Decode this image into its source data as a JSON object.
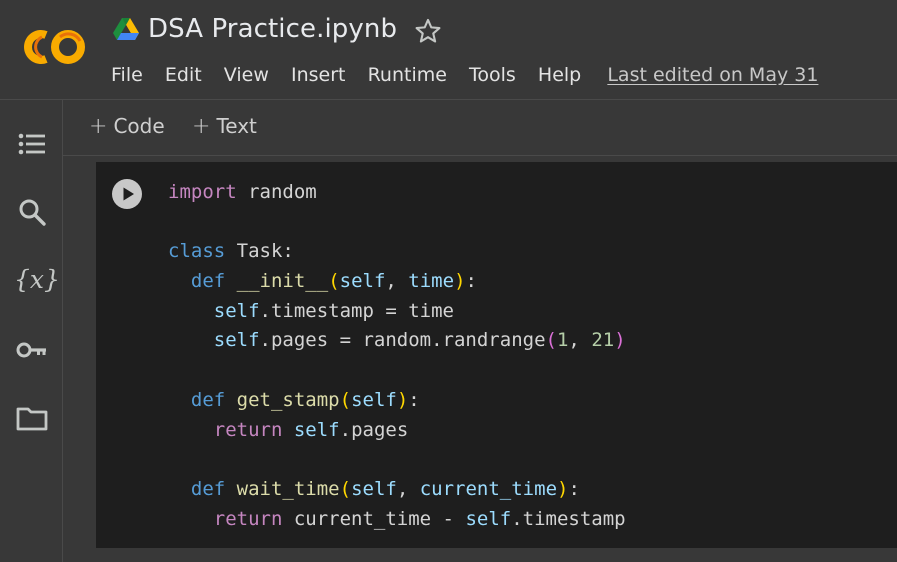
{
  "header": {
    "title": "DSA Practice.ipynb",
    "menu": [
      "File",
      "Edit",
      "View",
      "Insert",
      "Runtime",
      "Tools",
      "Help"
    ],
    "last_edited": "Last edited on May 31"
  },
  "toolbar": {
    "add_code_label": "Code",
    "add_text_label": "Text"
  },
  "sidebar": {
    "icons": [
      "table-of-contents-icon",
      "search-icon",
      "variables-icon",
      "key-icon",
      "folder-icon"
    ],
    "variables_glyph": "{x}"
  },
  "code": {
    "lines": [
      [
        [
          "kw",
          "import"
        ],
        [
          "t",
          " random"
        ]
      ],
      [],
      [
        [
          "kw2",
          "class"
        ],
        [
          "t",
          " Task:"
        ]
      ],
      [
        [
          "t",
          "  "
        ],
        [
          "kw2",
          "def"
        ],
        [
          "t",
          " "
        ],
        [
          "fn",
          "__init__"
        ],
        [
          "p1",
          "("
        ],
        [
          "slf",
          "self"
        ],
        [
          "t",
          ", "
        ],
        [
          "slf",
          "time"
        ],
        [
          "p1",
          ")"
        ],
        [
          "t",
          ":"
        ]
      ],
      [
        [
          "t",
          "    "
        ],
        [
          "slf",
          "self"
        ],
        [
          "t",
          ".timestamp = time"
        ]
      ],
      [
        [
          "t",
          "    "
        ],
        [
          "slf",
          "self"
        ],
        [
          "t",
          ".pages = random.randrange"
        ],
        [
          "p2",
          "("
        ],
        [
          "num",
          "1"
        ],
        [
          "t",
          ", "
        ],
        [
          "num",
          "21"
        ],
        [
          "p2",
          ")"
        ]
      ],
      [],
      [
        [
          "t",
          "  "
        ],
        [
          "kw2",
          "def"
        ],
        [
          "t",
          " "
        ],
        [
          "fn",
          "get_stamp"
        ],
        [
          "p1",
          "("
        ],
        [
          "slf",
          "self"
        ],
        [
          "p1",
          ")"
        ],
        [
          "t",
          ":"
        ]
      ],
      [
        [
          "t",
          "    "
        ],
        [
          "kw",
          "return"
        ],
        [
          "t",
          " "
        ],
        [
          "slf",
          "self"
        ],
        [
          "t",
          ".pages"
        ]
      ],
      [],
      [
        [
          "t",
          "  "
        ],
        [
          "kw2",
          "def"
        ],
        [
          "t",
          " "
        ],
        [
          "fn",
          "wait_time"
        ],
        [
          "p1",
          "("
        ],
        [
          "slf",
          "self"
        ],
        [
          "t",
          ", "
        ],
        [
          "slf",
          "current_time"
        ],
        [
          "p1",
          ")"
        ],
        [
          "t",
          ":"
        ]
      ],
      [
        [
          "t",
          "    "
        ],
        [
          "kw",
          "return"
        ],
        [
          "t",
          " current_time - "
        ],
        [
          "slf",
          "self"
        ],
        [
          "t",
          ".timestamp"
        ]
      ]
    ]
  },
  "colors": {
    "background": "#383838",
    "cell_background": "#1e1e1e",
    "keyword": "#c586c0",
    "keyword_def": "#569cd6",
    "identifier": "#9cdcfe",
    "function": "#dcdcaa",
    "number": "#b5cea8",
    "logo_orange": "#f9ab00",
    "logo_dark_orange": "#e8710a"
  }
}
